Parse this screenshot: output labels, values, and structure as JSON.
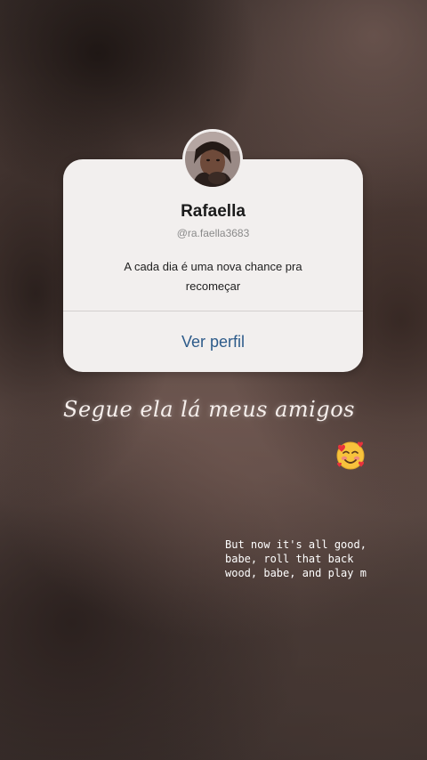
{
  "profile_card": {
    "name": "Rafaella",
    "handle": "@ra.faella3683",
    "bio_line1": "A cada dia é uma  nova chance pra",
    "bio_line2": "recomeçar",
    "view_profile_label": "Ver perfil"
  },
  "caption": {
    "text": "Segue ela lá meus amigos"
  },
  "sticker": {
    "icon": "smiling-face-with-hearts-icon"
  },
  "lyrics": {
    "line1": "But now it's all good,",
    "line2": "babe, roll that back",
    "line3": "wood, babe, and play m"
  },
  "colors": {
    "card_background": "#f2efee",
    "link_blue": "#2d5b8a",
    "caption_text": "#f6efec"
  }
}
